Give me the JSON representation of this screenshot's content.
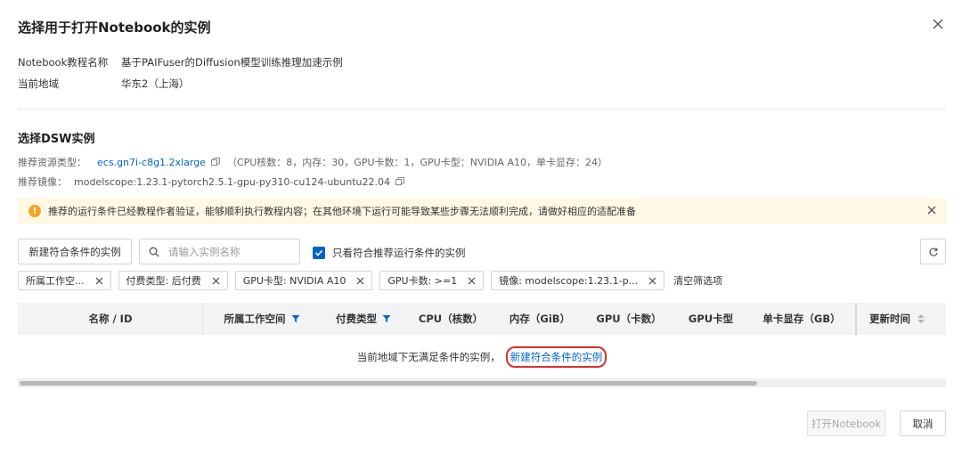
{
  "dialog": {
    "title": "选择用于打开Notebook的实例"
  },
  "info": {
    "tutorial_label": "Notebook教程名称",
    "tutorial_value": "基于PAIFuser的Diffusion模型训练推理加速示例",
    "region_label": "当前地域",
    "region_value": "华东2（上海）"
  },
  "section": {
    "title": "选择DSW实例",
    "resource_label": "推荐资源类型：",
    "resource_value": "ecs.gn7i-c8g1.2xlarge",
    "resource_detail": "（CPU核数：8，内存：30，GPU卡数：1，GPU卡型：NVIDIA A10，单卡显存：24）",
    "image_label": "推荐镜像：",
    "image_value": "modelscope:1.23.1-pytorch2.5.1-gpu-py310-cu124-ubuntu22.04"
  },
  "alert": {
    "text": "推荐的运行条件已经教程作者验证，能够顺利执行教程内容；在其他环境下运行可能导致某些步骤无法顺利完成，请做好相应的适配准备",
    "color": "#fff8e5"
  },
  "toolbar": {
    "new_instance_label": "新建符合条件的实例",
    "search_placeholder": "请输入实例名称",
    "checkbox_label": "只看符合推荐运行条件的实例",
    "checkbox_checked": true
  },
  "filters": {
    "chips": [
      "所属工作空...",
      "付费类型: 后付费",
      "GPU卡型: NVIDIA A10",
      "GPU卡数: >=1",
      "镜像: modelscope:1.23.1-p..."
    ],
    "clear_label": "清空筛选项"
  },
  "table": {
    "columns": [
      "名称 / ID",
      "所属工作空间",
      "付费类型",
      "CPU（核数）",
      "内存（GiB）",
      "GPU（卡数）",
      "GPU卡型",
      "单卡显存（GB）",
      "更新时间"
    ],
    "empty_text": "当前地域下无满足条件的实例，",
    "empty_link": "新建符合条件的实例"
  },
  "footer": {
    "open_label": "打开Notebook",
    "cancel_label": "取消"
  },
  "colors": {
    "accent": "#0064c8",
    "highlight": "#d9302c",
    "warning": "#f5a623"
  }
}
